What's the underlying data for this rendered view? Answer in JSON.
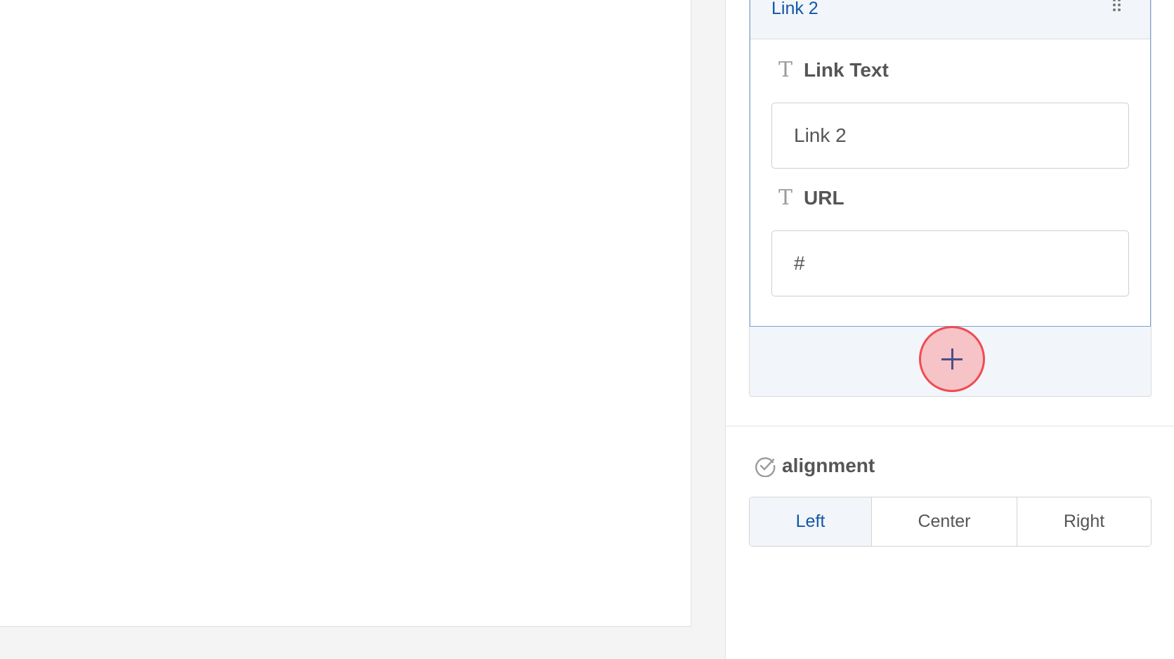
{
  "repeater": {
    "item_title": "Link 2",
    "fields": [
      {
        "label": "Link Text",
        "value": "Link 2",
        "icon": "text-type-icon"
      },
      {
        "label": "URL",
        "value": "#",
        "icon": "text-type-icon"
      }
    ],
    "add_icon": "plus-icon"
  },
  "alignment": {
    "label": "alignment",
    "icon": "check-circle-icon",
    "options": [
      "Left",
      "Center",
      "Right"
    ],
    "selected": "Left"
  },
  "colors": {
    "accent": "#1357a8",
    "add_button_fill": "#f6c3c7",
    "add_button_border": "#f04a52",
    "item_border": "#7aa2d6"
  }
}
